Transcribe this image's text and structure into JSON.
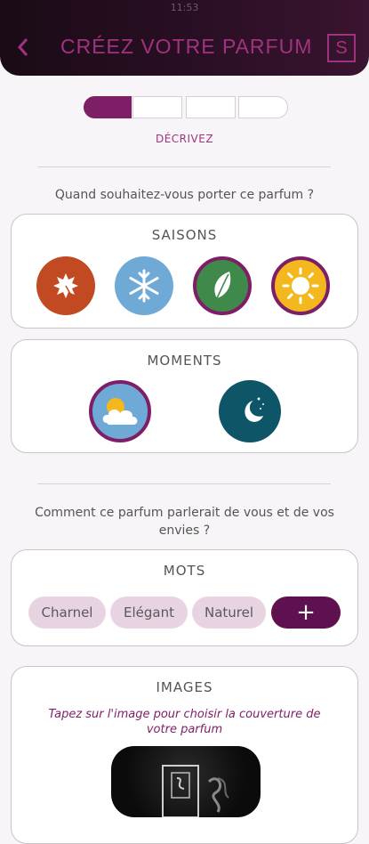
{
  "status_bar": {
    "time": "11:53"
  },
  "header": {
    "title": "CRÉEZ VOTRE PARFUM",
    "logo_letter": "S"
  },
  "progress": {
    "current_step": 1,
    "total_steps": 4,
    "step_label": "DÉCRIVEZ"
  },
  "question_wear": "Quand souhaitez-vous porter ce parfum ?",
  "seasons": {
    "title": "SAISONS",
    "items": [
      {
        "icon": "autumn-leaf-icon",
        "color": "#c24a22",
        "selected": false
      },
      {
        "icon": "snowflake-icon",
        "color": "#6fa9d6",
        "selected": false
      },
      {
        "icon": "spring-leaf-icon",
        "color": "#3f8a4a",
        "selected": true
      },
      {
        "icon": "sun-icon",
        "color": "#f2b81e",
        "selected": true
      }
    ]
  },
  "moments": {
    "title": "MOMENTS",
    "items": [
      {
        "icon": "day-cloud-icon",
        "color": "#6fa9d6",
        "selected": true
      },
      {
        "icon": "night-moon-icon",
        "color": "#0f5568",
        "selected": false
      }
    ]
  },
  "question_words": "Comment ce parfum parlerait de vous et de vos envies ?",
  "words": {
    "title": "MOTS",
    "tags": [
      "Charnel",
      "Elégant",
      "Naturel"
    ],
    "add_label": "+"
  },
  "images": {
    "title": "IMAGES",
    "hint": "Tapez sur l'image pour choisir la couverture de votre parfum"
  },
  "colors": {
    "accent": "#7e1e66",
    "title": "#a0337f"
  }
}
